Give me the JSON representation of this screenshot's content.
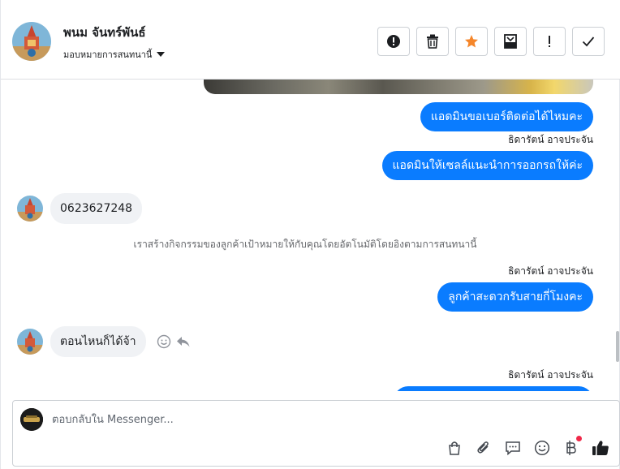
{
  "header": {
    "contact_name": "พนม จันทร์พันธ์",
    "assign_label": "มอบหมายการสนทนานี้",
    "actions": [
      "warning-icon",
      "trash-icon",
      "star-icon",
      "envelope-icon",
      "exclamation-icon",
      "check-icon"
    ],
    "star_color": "#f5862a"
  },
  "conversation": {
    "messages": [
      {
        "direction": "out",
        "text": "แอดมินขอเบอร์ติดต่อได้ไหมคะ"
      },
      {
        "direction": "out",
        "sender": "ธิดารัตน์ อาจประจัน",
        "text": "แอดมินให้เซลล์แนะนำการออกรถให้ค่ะ"
      },
      {
        "direction": "in",
        "text": "0623627248"
      },
      {
        "direction": "system",
        "text": "เราสร้างกิจกรรมของลูกค้าเป้าหมายให้กับคุณโดยอัตโนมัติโดยอิงตามการสนทนานี้"
      },
      {
        "direction": "out",
        "sender": "ธิดารัตน์ อาจประจัน",
        "text": "ลูกค้าสะดวกรับสายกี่โมงคะ"
      },
      {
        "direction": "in",
        "text": "ตอนไหนก็ได้จ้า"
      },
      {
        "direction": "out",
        "sender": "ธิดารัตน์ อาจประจัน",
        "text": ""
      }
    ]
  },
  "composer": {
    "placeholder": "ตอบกลับใน Messenger...",
    "tools": [
      "shopping-bag-icon",
      "paperclip-icon",
      "saved-reply-icon",
      "emoji-icon",
      "baht-payment-icon",
      "thumbs-up-icon"
    ]
  },
  "colors": {
    "outgoing_bubble": "#0a7cff",
    "incoming_bubble": "#f0f2f5",
    "notification_dot": "#f02849"
  }
}
